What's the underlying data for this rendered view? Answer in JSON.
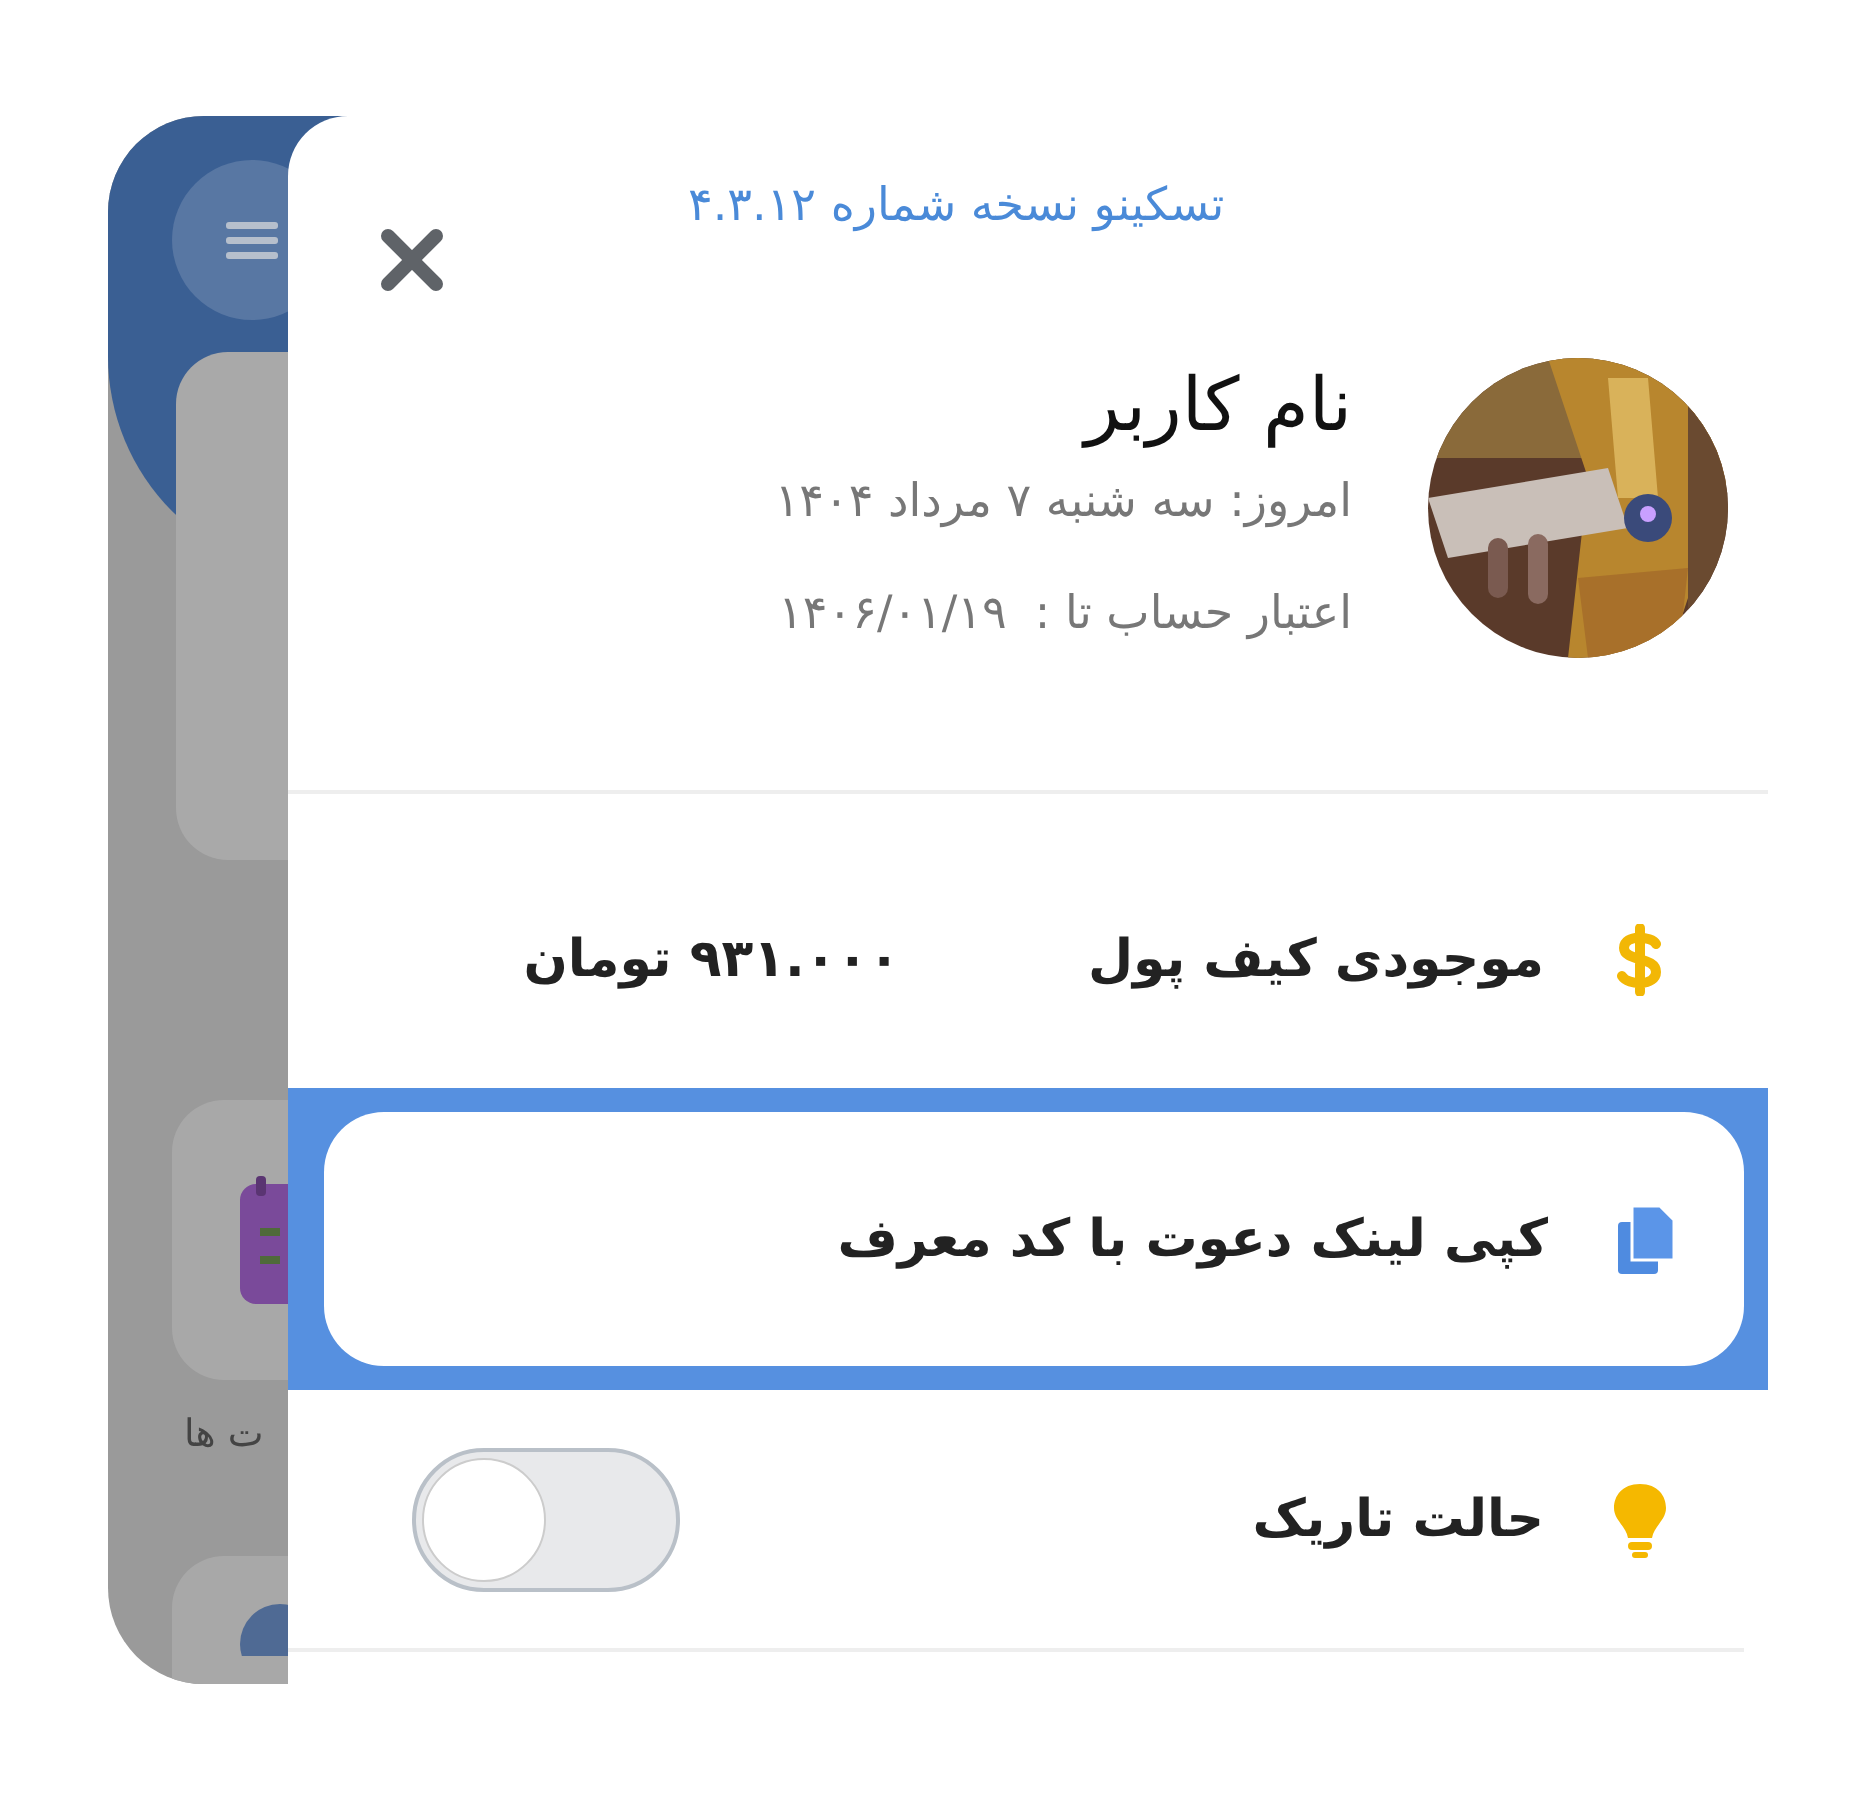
{
  "background": {
    "section_label": "ت ها"
  },
  "drawer": {
    "version": "تسکینو نسخه شماره ۴.۳.۱۲",
    "user": {
      "name": "نام کاربر",
      "today": "امروز: سه شنبه ۷ مرداد ۱۴۰۴",
      "expiry_label": "اعتبار حساب تا :",
      "expiry_date": "۱۴۰۶/۰۱/۱۹"
    },
    "items": [
      {
        "kind": "value",
        "label": "موجودی کیف پول",
        "value": "۹۳۱.۰۰۰ تومان",
        "selected": false
      },
      {
        "kind": "action",
        "label": "کپی لینک دعوت با کد معرف",
        "selected": true
      },
      {
        "kind": "toggle",
        "label": "حالت تاریک",
        "on": false,
        "selected": false
      }
    ]
  }
}
